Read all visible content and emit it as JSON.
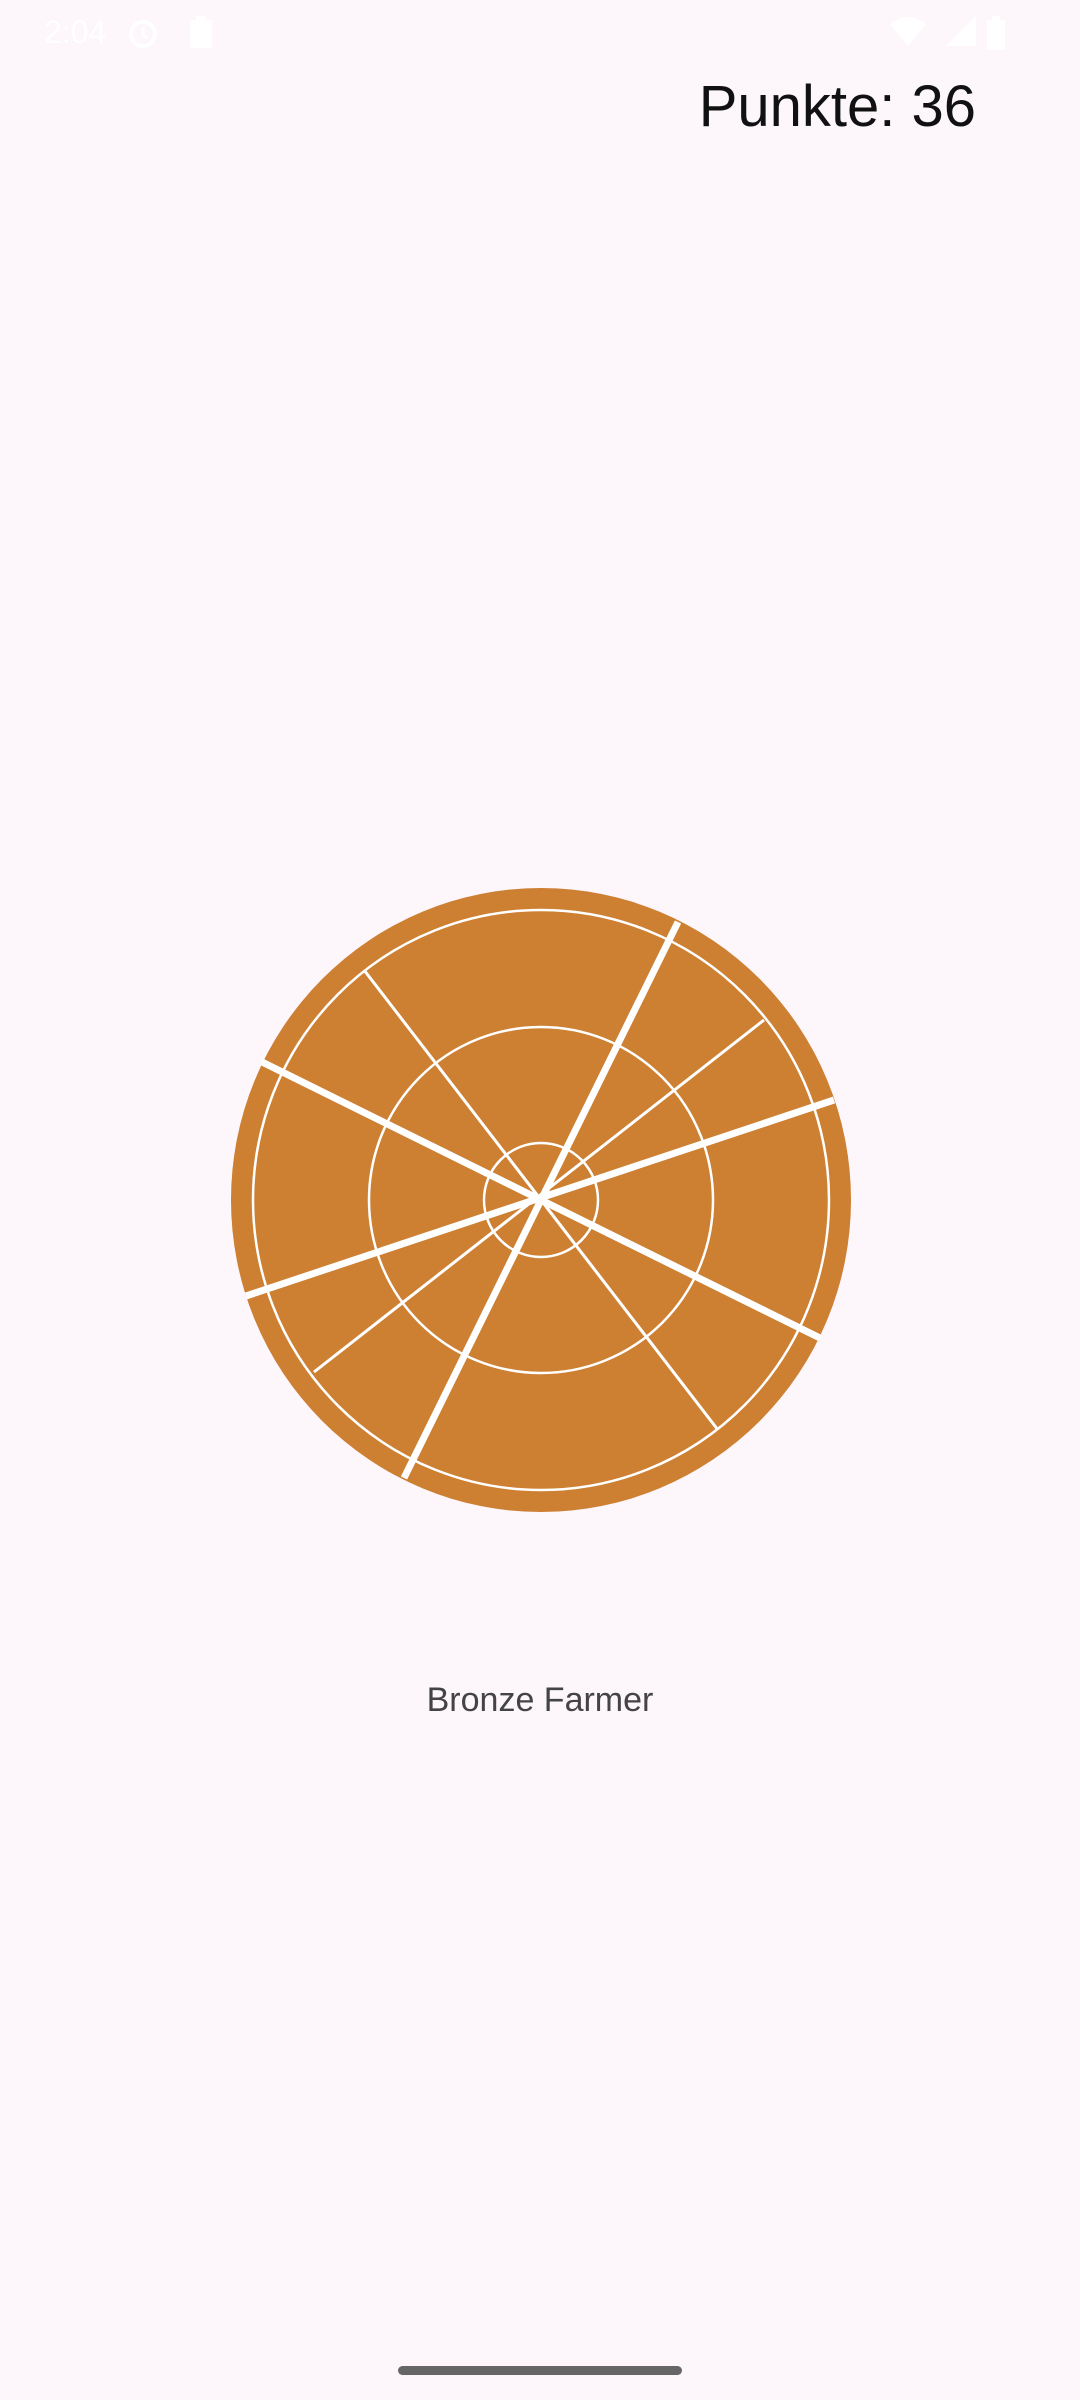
{
  "status_bar": {
    "time": "2:04",
    "icons": [
      "alarm-icon",
      "battery-saver-icon",
      "wifi-icon",
      "signal-icon",
      "battery-icon"
    ]
  },
  "score": {
    "text": "Punkte: 36"
  },
  "pizza": {
    "crust_color": "#CD7F32",
    "line_color": "#FFFFFF",
    "icon": "pizza-icon"
  },
  "rank": {
    "label": "Bronze Farmer"
  },
  "navigation": {
    "icon": "home-indicator-icon"
  }
}
